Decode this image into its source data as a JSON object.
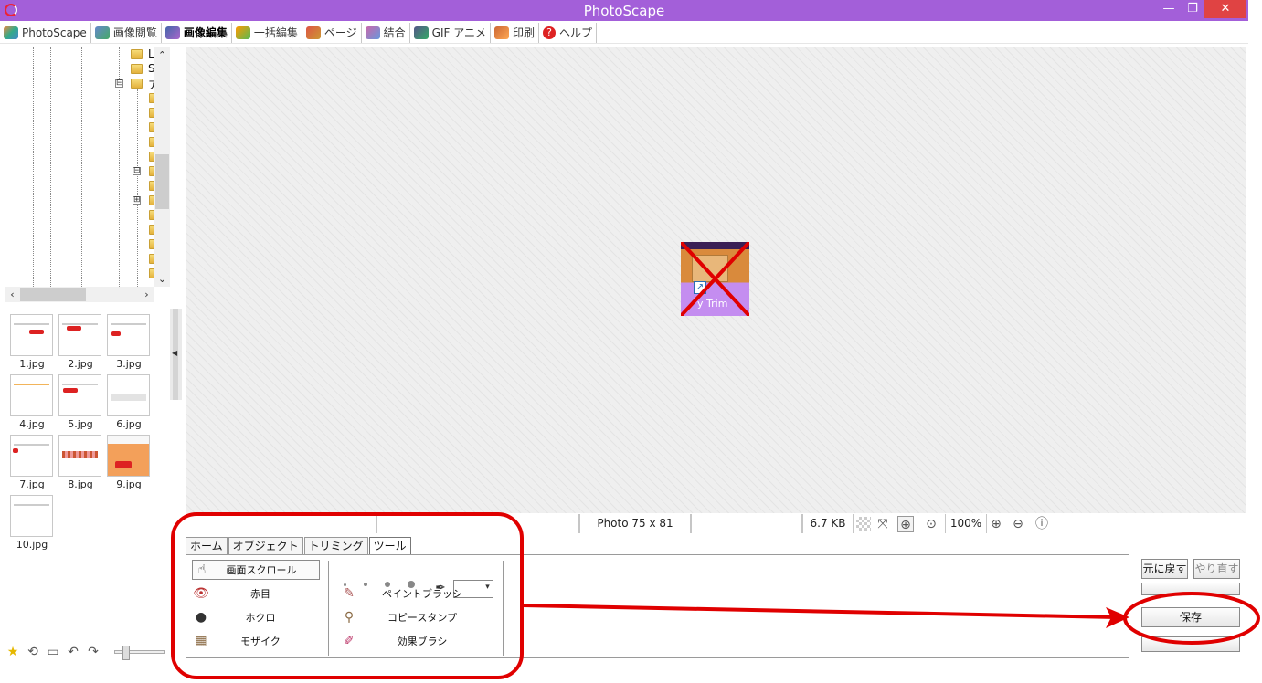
{
  "window": {
    "title": "PhotoScape",
    "minimize": "—",
    "maximize": "❐",
    "close": "✕"
  },
  "menu": [
    {
      "label": "PhotoScape",
      "name": "menu-photoscape",
      "icon": "photoscape-icon"
    },
    {
      "label": "画像閲覧",
      "name": "menu-viewer",
      "icon": "viewer-icon"
    },
    {
      "label": "画像編集",
      "name": "menu-editor",
      "icon": "editor-icon",
      "active": true
    },
    {
      "label": "一括編集",
      "name": "menu-batch",
      "icon": "batch-icon"
    },
    {
      "label": "ページ",
      "name": "menu-page",
      "icon": "page-icon"
    },
    {
      "label": "結合",
      "name": "menu-combine",
      "icon": "combine-icon"
    },
    {
      "label": "GIF アニメ",
      "name": "menu-gif",
      "icon": "gif-icon"
    },
    {
      "label": "印刷",
      "name": "menu-print",
      "icon": "print-icon"
    },
    {
      "label": "ヘルプ",
      "name": "menu-help",
      "icon": "help-icon"
    }
  ],
  "tree": {
    "labels": [
      "L",
      "S",
      "ア"
    ],
    "expanders": [
      "⊟",
      "⊟",
      "⊞"
    ]
  },
  "scroll": {
    "up": "⌃",
    "down": "⌄",
    "left": "‹",
    "right": "›"
  },
  "thumbnails": [
    {
      "name": "1.jpg"
    },
    {
      "name": "2.jpg"
    },
    {
      "name": "3.jpg"
    },
    {
      "name": "4.jpg"
    },
    {
      "name": "5.jpg"
    },
    {
      "name": "6.jpg"
    },
    {
      "name": "7.jpg"
    },
    {
      "name": "8.jpg"
    },
    {
      "name": "9.jpg"
    },
    {
      "name": "10.jpg"
    }
  ],
  "photo": {
    "caption": "y Trim",
    "shortcut_glyph": "↗"
  },
  "status": {
    "dimensions": "Photo 75 x 81",
    "file_size": "6.7 KB",
    "zoom": "100%"
  },
  "tabs": [
    {
      "label": "ホーム"
    },
    {
      "label": "オブジェクト"
    },
    {
      "label": "トリミング"
    },
    {
      "label": "ツール",
      "active": true
    }
  ],
  "tools": {
    "left": [
      {
        "label": "画面スクロール",
        "icon": "hand-icon",
        "glyph": "☝"
      },
      {
        "label": "赤目",
        "icon": "red-eye-icon",
        "glyph": "👁"
      },
      {
        "label": "ホクロ",
        "icon": "mole-icon",
        "glyph": "●"
      },
      {
        "label": "モザイク",
        "icon": "mosaic-icon",
        "glyph": "▦"
      }
    ],
    "right": [
      {
        "label": "ペイントブラッシ",
        "icon": "paint-brush-icon",
        "glyph": "✎"
      },
      {
        "label": "コピースタンプ",
        "icon": "copy-stamp-icon",
        "glyph": "⚲"
      },
      {
        "label": "効果ブラシ",
        "icon": "effect-brush-icon",
        "glyph": "✐"
      }
    ],
    "eyedropper_glyph": "✒"
  },
  "buttons": {
    "undo": "元に戻す",
    "redo": "やり直す",
    "save": "保存"
  },
  "colors": {
    "titlebar": "#a35fd9",
    "close_button": "#e04343",
    "annotation_red": "#e00000"
  }
}
